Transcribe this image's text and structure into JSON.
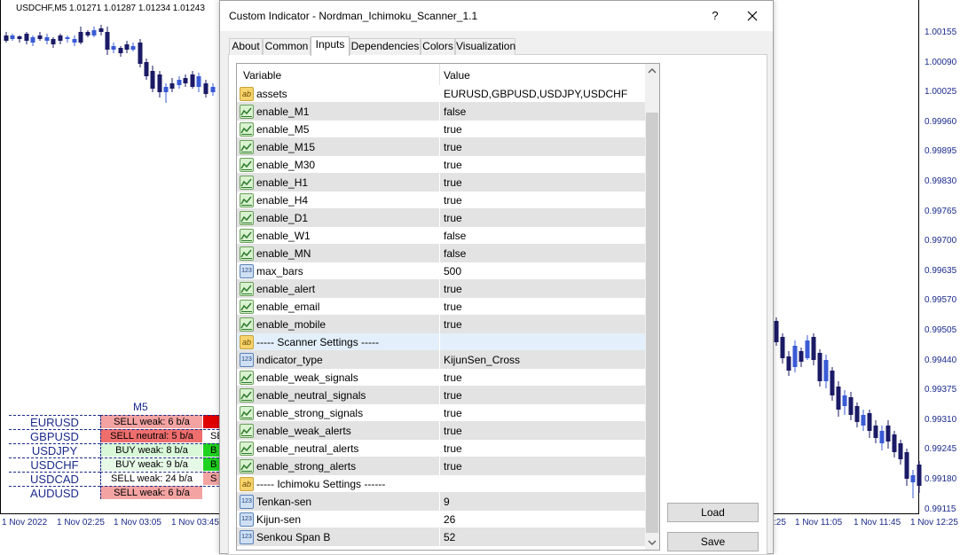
{
  "chart": {
    "title": "USDCHF,M5  1.01271 1.01287 1.01234 1.01243",
    "price_labels": [
      "1.00155",
      "1.00090",
      "1.00025",
      "0.99960",
      "0.99895",
      "0.99830",
      "0.99765",
      "0.99700",
      "0.99635",
      "0.99570",
      "0.99505",
      "0.99440",
      "0.99375",
      "0.99310",
      "0.99245",
      "0.99180",
      "0.99115"
    ],
    "time_labels": [
      "1 Nov 2022",
      "1 Nov 02:25",
      "1 Nov 03:05",
      "1 Nov 03:45",
      ":25",
      "1 Nov 11:05",
      "1 Nov 11:45",
      "1 Nov 12:25"
    ],
    "bull_color": "#3a5bd6",
    "bear_color": "#1a1a66"
  },
  "scanner": {
    "timeframe": "M5",
    "rows": [
      {
        "symbol": "EURUSD",
        "signal": "SELL weak: 6 b/a",
        "color": "#f4a3a3",
        "next": "",
        "next_color": "#e00000"
      },
      {
        "symbol": "GBPUSD",
        "signal": "SELL neutral: 5 b/a",
        "color": "#ee6e6e",
        "next": "SE",
        "next_color": "#ffffff"
      },
      {
        "symbol": "USDJPY",
        "signal": "BUY weak: 8 b/a",
        "color": "#d8f8d8",
        "next": "B",
        "next_color": "#1fd21f"
      },
      {
        "symbol": "USDCHF",
        "signal": "BUY weak: 9 b/a",
        "color": "#e6f8e6",
        "next": "B",
        "next_color": "#1fd21f"
      },
      {
        "symbol": "USDCAD",
        "signal": "SELL weak: 24 b/a",
        "color": "#ffffff",
        "next": "S",
        "next_color": "#f4a3a3"
      },
      {
        "symbol": "AUDUSD",
        "signal": "SELL weak: 6 b/a",
        "color": "#f4a3a3",
        "next": "",
        "next_color": "#ffffff"
      }
    ]
  },
  "dialog": {
    "title": "Custom Indicator - Nordman_Ichimoku_Scanner_1.1",
    "help": "?",
    "tabs": [
      "About",
      "Common",
      "Inputs",
      "Dependencies",
      "Colors",
      "Visualization"
    ],
    "active_tab": "Inputs",
    "grid": {
      "col_variable": "Variable",
      "col_value": "Value",
      "rows": [
        {
          "type": "ab",
          "name": "assets",
          "value": "EURUSD,GBPUSD,USDJPY,USDCHF"
        },
        {
          "type": "bool",
          "name": "enable_M1",
          "value": "false"
        },
        {
          "type": "bool",
          "name": "enable_M5",
          "value": "true"
        },
        {
          "type": "bool",
          "name": "enable_M15",
          "value": "true"
        },
        {
          "type": "bool",
          "name": "enable_M30",
          "value": "true"
        },
        {
          "type": "bool",
          "name": "enable_H1",
          "value": "true"
        },
        {
          "type": "bool",
          "name": "enable_H4",
          "value": "true"
        },
        {
          "type": "bool",
          "name": "enable_D1",
          "value": "true"
        },
        {
          "type": "bool",
          "name": "enable_W1",
          "value": "false"
        },
        {
          "type": "bool",
          "name": "enable_MN",
          "value": "false"
        },
        {
          "type": "num",
          "name": "max_bars",
          "value": "500"
        },
        {
          "type": "bool",
          "name": "enable_alert",
          "value": "true"
        },
        {
          "type": "bool",
          "name": "enable_email",
          "value": "true"
        },
        {
          "type": "bool",
          "name": "enable_mobile",
          "value": "true"
        },
        {
          "type": "ab",
          "name": "----- Scanner Settings -----",
          "value": "",
          "section": true
        },
        {
          "type": "num",
          "name": "indicator_type",
          "value": "KijunSen_Cross"
        },
        {
          "type": "bool",
          "name": "enable_weak_signals",
          "value": "true"
        },
        {
          "type": "bool",
          "name": "enable_neutral_signals",
          "value": "true"
        },
        {
          "type": "bool",
          "name": "enable_strong_signals",
          "value": "true"
        },
        {
          "type": "bool",
          "name": "enable_weak_alerts",
          "value": "true"
        },
        {
          "type": "bool",
          "name": "enable_neutral_alerts",
          "value": "true"
        },
        {
          "type": "bool",
          "name": "enable_strong_alerts",
          "value": "true"
        },
        {
          "type": "ab",
          "name": "----- Ichimoku Settings ------",
          "value": ""
        },
        {
          "type": "num",
          "name": "Tenkan-sen",
          "value": "9"
        },
        {
          "type": "num",
          "name": "Kijun-sen",
          "value": "26"
        },
        {
          "type": "num",
          "name": "Senkou Span B",
          "value": "52"
        }
      ]
    },
    "load_label": "Load",
    "save_label": "Save"
  }
}
